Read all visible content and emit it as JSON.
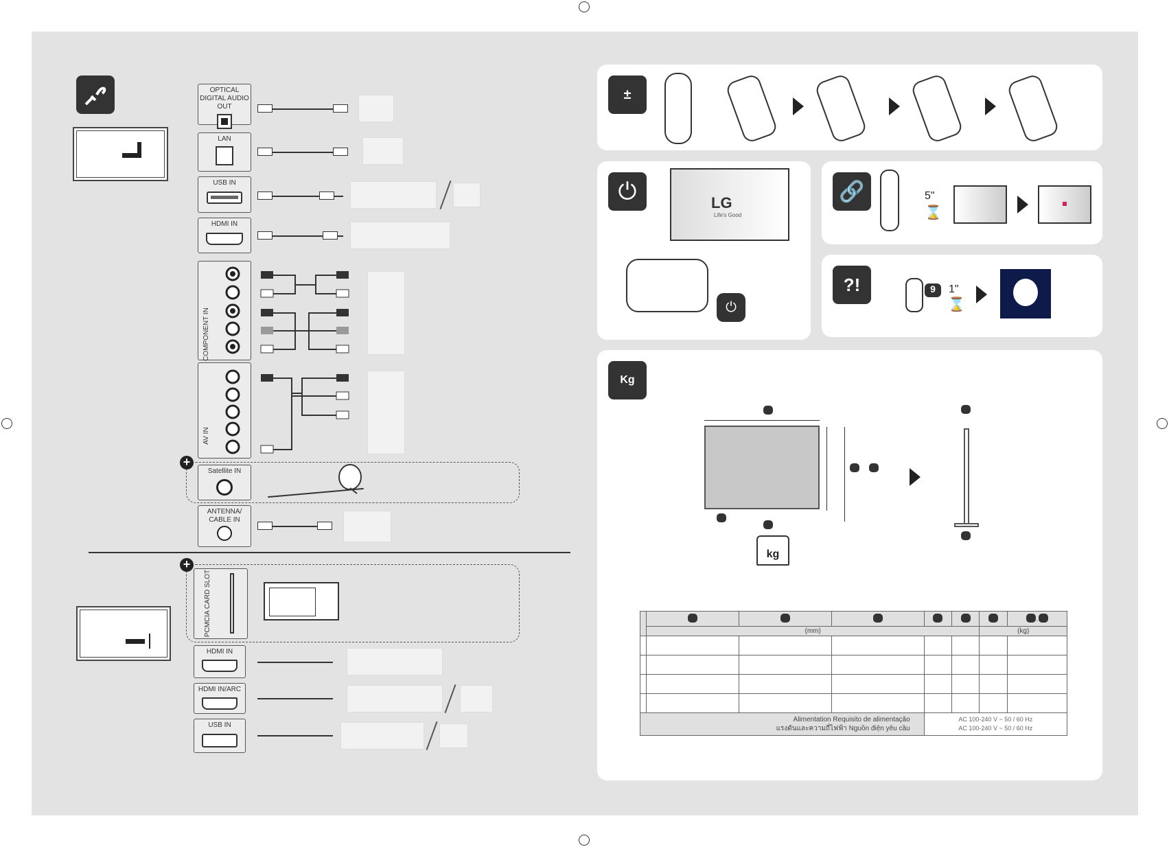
{
  "ports_top": [
    {
      "label": "OPTICAL DIGITAL AUDIO OUT",
      "icon": "optical-port-icon"
    },
    {
      "label": "LAN",
      "icon": "lan-port-icon"
    },
    {
      "label": "USB IN",
      "icon": "usb-port-icon"
    },
    {
      "label": "HDMI IN",
      "icon": "hdmi-port-icon"
    },
    {
      "label": "COMPONENT IN",
      "icon": "component-port-icon"
    },
    {
      "label": "AV IN",
      "icon": "av-port-icon"
    },
    {
      "label": "Satellite IN",
      "icon": "satellite-port-icon"
    },
    {
      "label": "ANTENNA/ CABLE IN",
      "icon": "antenna-port-icon"
    }
  ],
  "ports_side": [
    {
      "label": "PCMCIA CARD SLOT",
      "icon": "pcmcia-slot-icon"
    },
    {
      "label": "HDMI IN",
      "icon": "hdmi-port-icon"
    },
    {
      "label": "HDMI IN/ARC",
      "icon": "hdmi-port-icon"
    },
    {
      "label": "USB IN",
      "icon": "usb-port-icon"
    }
  ],
  "power": {
    "logo": "LG",
    "tagline": "Life's Good"
  },
  "pairing": {
    "hold_time": "5\""
  },
  "support": {
    "hold_time": "1\"",
    "key": "9"
  },
  "table": {
    "unit_mm": "(mm)",
    "unit_kg": "(kg)",
    "power_label_1": "Alimentation  Requisito de alimentação",
    "power_label_2": "แรงดันและความถี่ไฟฟ้า  Nguồn điện yêu cầu",
    "power_value_1": "AC 100-240 V ~ 50 / 60 Hz",
    "power_value_2": "AC 100-240 V ~ 50 / 60 Hz"
  },
  "colors": {
    "background": "#e3e3e3",
    "panel": "#ffffff",
    "icon_box": "#333333",
    "support_bg": "#0d1a4a"
  }
}
